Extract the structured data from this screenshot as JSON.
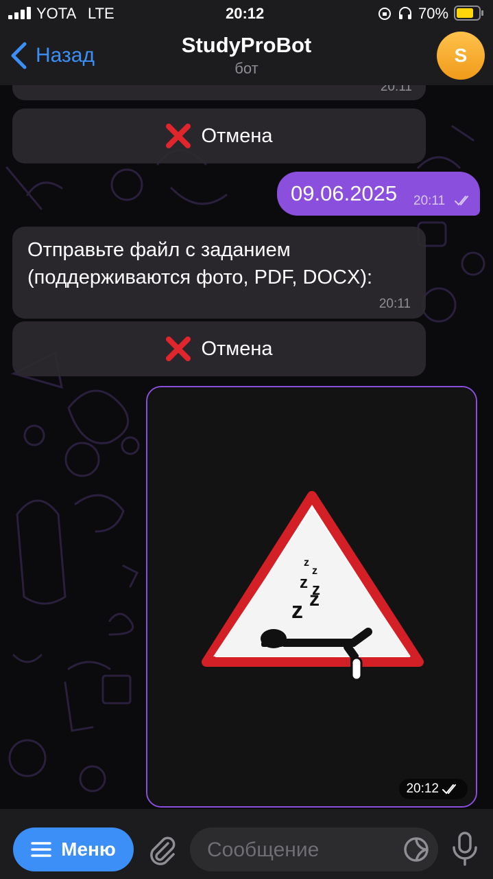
{
  "status_bar": {
    "carrier": "YOTA",
    "network": "LTE",
    "time": "20:12",
    "battery": "70%"
  },
  "header": {
    "back_label": "Назад",
    "title": "StudyProBot",
    "subtitle": "бот",
    "avatar_letter": "S",
    "avatar_color": "#f5a623"
  },
  "messages": {
    "top_partial_time": "20:11",
    "cancel_button_1": "Отмена",
    "date_message": "09.06.2025",
    "date_message_time": "20:11",
    "prompt_text": "Отправьте файл с заданием (поддерживаются фото, PDF, DOCX):",
    "prompt_time": "20:11",
    "cancel_button_2": "Отмена",
    "image_time": "20:12",
    "image_description_icon": "sleeping-person-road-sign"
  },
  "bottom_bar": {
    "menu_label": "Меню",
    "input_placeholder": "Сообщение"
  },
  "colors": {
    "accent": "#3b8ff6",
    "outgoing": "#8a4fdc",
    "incoming": "#2c2a2e",
    "cancel_cross": "#e0262c"
  }
}
